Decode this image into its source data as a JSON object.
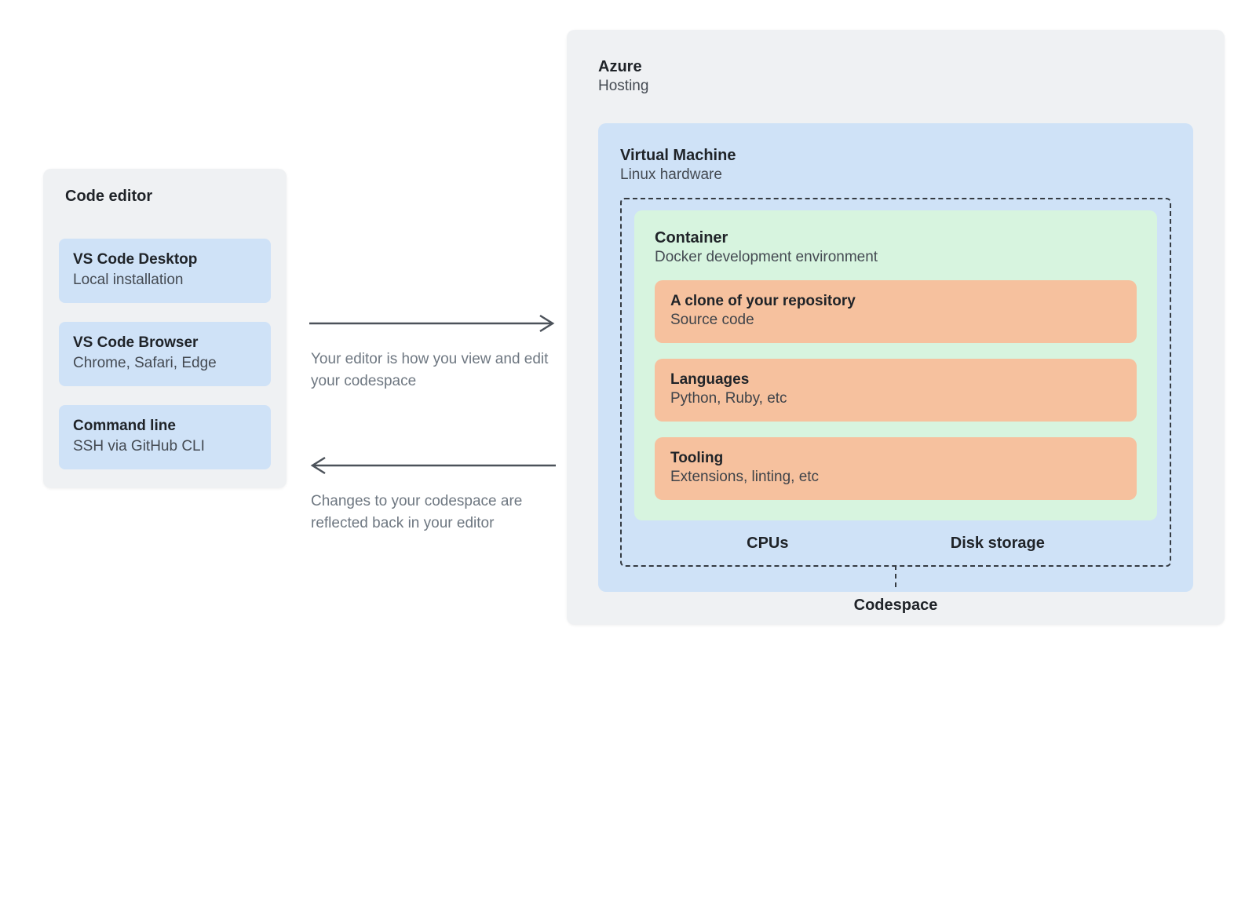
{
  "editor": {
    "title": "Code editor",
    "items": [
      {
        "title": "VS Code Desktop",
        "sub": "Local installation"
      },
      {
        "title": "VS Code Browser",
        "sub": "Chrome, Safari, Edge"
      },
      {
        "title": "Command line",
        "sub": "SSH via GitHub CLI"
      }
    ]
  },
  "arrows": {
    "forward_caption": "Your editor is how you view and edit your codespace",
    "back_caption": "Changes to your codespace are reflected back in your editor"
  },
  "azure": {
    "title": "Azure",
    "sub": "Hosting",
    "vm": {
      "title": "Virtual Machine",
      "sub": "Linux hardware",
      "container": {
        "title": "Container",
        "sub": "Docker development environment",
        "items": [
          {
            "title": "A clone of your repository",
            "sub": "Source code"
          },
          {
            "title": "Languages",
            "sub": "Python, Ruby, etc"
          },
          {
            "title": "Tooling",
            "sub": "Extensions, linting, etc"
          }
        ]
      },
      "resources": {
        "cpus": "CPUs",
        "disk": "Disk storage"
      },
      "codespace_label": "Codespace"
    }
  }
}
